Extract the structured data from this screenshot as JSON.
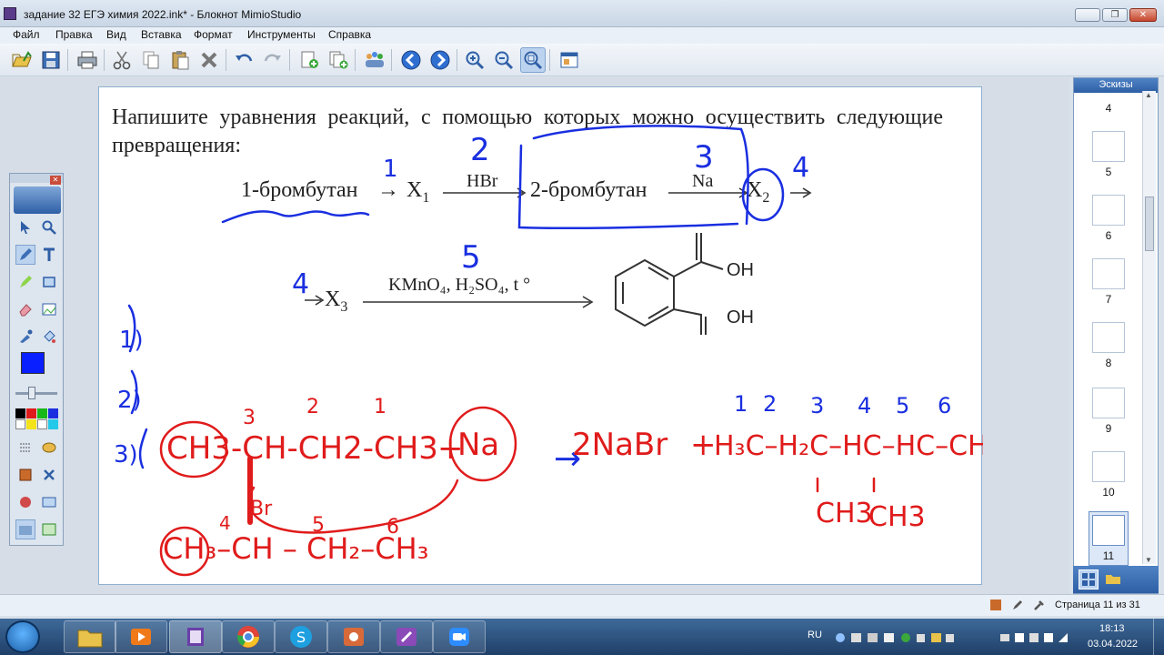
{
  "window": {
    "title": "задание 32 ЕГЭ химия 2022.ink* - Блокнот MimioStudio",
    "minimize_label": "▭",
    "maximize_label": "❐",
    "close_label": "✕"
  },
  "menu": {
    "file": "Файл",
    "edit": "Правка",
    "view": "Вид",
    "insert": "Вставка",
    "format": "Формат",
    "tools": "Инструменты",
    "help": "Справка"
  },
  "page": {
    "task_text": "Напишите уравнения реакций, с помощью которых можно осуществить следующие превращения:",
    "scheme1": {
      "start": "1-бромбутан",
      "x1": "X",
      "x1_sub": "1",
      "reagent1": "HBr",
      "mid": "2-бромбутан",
      "reagent2": "Na",
      "x2": "X",
      "x2_sub": "2"
    },
    "scheme2": {
      "x3": "X",
      "x3_sub": "3",
      "reagent": "KMnO₄, H₂SO₄, t °",
      "oh1": "OH",
      "oh2": "OH"
    },
    "ink_blue_numbers": [
      "1",
      "2",
      "3",
      "4",
      "4",
      "5"
    ],
    "ink_red_text": [
      "CH3-CH-CH2-CH3",
      "Br",
      "Na",
      "2NaBr",
      "CH3",
      "CH3"
    ]
  },
  "thumbnails": {
    "header": "Эскизы",
    "pages": [
      "4",
      "5",
      "6",
      "7",
      "8",
      "9",
      "10",
      "11"
    ],
    "selected": "11"
  },
  "status": {
    "page_info": "Страница 11 из 31"
  },
  "taskbar": {
    "lang": "RU",
    "time": "18:13",
    "date": "03.04.2022"
  },
  "colors": {
    "ink_blue": "#1a2fe0",
    "ink_red": "#e01b1b",
    "selected_color": "#0a1fff"
  },
  "icons": [
    "open-icon",
    "save-icon",
    "print-icon",
    "cut-icon",
    "copy-icon",
    "paste-icon",
    "delete-icon",
    "undo-icon",
    "redo-icon",
    "new-page-icon",
    "duplicate-page-icon",
    "collaborate-icon",
    "back-icon",
    "forward-icon",
    "zoom-in-icon",
    "zoom-out-icon",
    "zoom-fit-icon",
    "gallery-icon"
  ]
}
